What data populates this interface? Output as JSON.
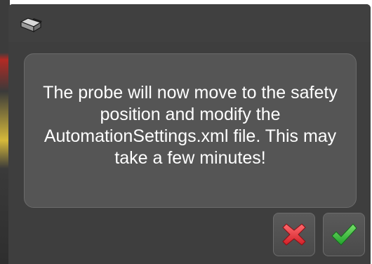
{
  "dialog": {
    "icon": "probe-icon",
    "message": "The probe will now move to the safety position and modify the AutomationSettings.xml file. This may take a few minutes!",
    "buttons": {
      "cancel": {
        "icon": "red-x-icon",
        "color": "#e8343a"
      },
      "confirm": {
        "icon": "green-check-icon",
        "color": "#3cc83c"
      }
    }
  },
  "colors": {
    "dialog_background": "#3e3e3e",
    "panel_background": "#555555",
    "text": "#ffffff"
  }
}
